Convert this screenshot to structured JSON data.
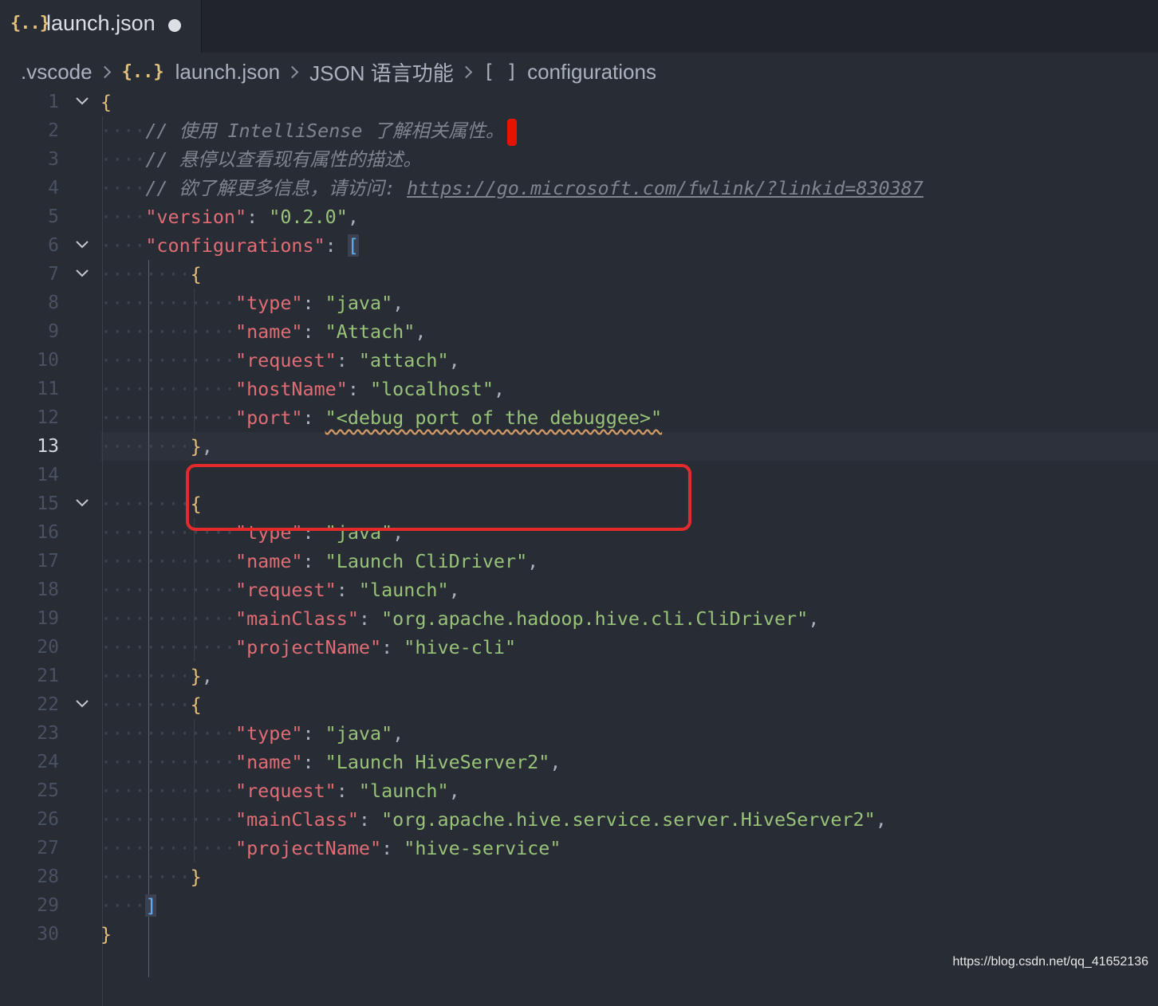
{
  "tab": {
    "icon": "{..}",
    "title": "launch.json",
    "dirty_indicator": "●"
  },
  "breadcrumb": [
    {
      "label": ".vscode"
    },
    {
      "icon": "{..}",
      "label": "launch.json"
    },
    {
      "label": "JSON 语言功能"
    },
    {
      "icon": "[ ]",
      "label": "configurations"
    }
  ],
  "active_line": 13,
  "lines": [
    {
      "n": "1",
      "fold": true,
      "indent": 0,
      "tokens": [
        {
          "t": "{",
          "c": "b1"
        }
      ]
    },
    {
      "n": "2",
      "fold": false,
      "indent": 1,
      "tokens": [
        {
          "t": "// 使用 IntelliSense 了解相关属性。",
          "c": "c"
        }
      ],
      "cursor": true
    },
    {
      "n": "3",
      "fold": false,
      "indent": 1,
      "tokens": [
        {
          "t": "// 悬停以查看现有属性的描述。",
          "c": "c"
        }
      ]
    },
    {
      "n": "4",
      "fold": false,
      "indent": 1,
      "tokens": [
        {
          "t": "// 欲了解更多信息，请访问: ",
          "c": "c"
        },
        {
          "t": "https://go.microsoft.com/fwlink/?linkid=830387",
          "c": "cu"
        }
      ]
    },
    {
      "n": "5",
      "fold": false,
      "indent": 1,
      "tokens": [
        {
          "t": "\"version\"",
          "c": "k"
        },
        {
          "t": ": ",
          "c": "p"
        },
        {
          "t": "\"0.2.0\"",
          "c": "s"
        },
        {
          "t": ",",
          "c": "p"
        }
      ]
    },
    {
      "n": "6",
      "fold": true,
      "indent": 1,
      "tokens": [
        {
          "t": "\"configurations\"",
          "c": "k"
        },
        {
          "t": ": ",
          "c": "p"
        },
        {
          "t": "[",
          "c": "b2"
        }
      ]
    },
    {
      "n": "7",
      "fold": true,
      "indent": 2,
      "tokens": [
        {
          "t": "{",
          "c": "b1"
        }
      ]
    },
    {
      "n": "8",
      "fold": false,
      "indent": 3,
      "tokens": [
        {
          "t": "\"type\"",
          "c": "k"
        },
        {
          "t": ": ",
          "c": "p"
        },
        {
          "t": "\"java\"",
          "c": "s"
        },
        {
          "t": ",",
          "c": "p"
        }
      ]
    },
    {
      "n": "9",
      "fold": false,
      "indent": 3,
      "tokens": [
        {
          "t": "\"name\"",
          "c": "k"
        },
        {
          "t": ": ",
          "c": "p"
        },
        {
          "t": "\"Attach\"",
          "c": "s"
        },
        {
          "t": ",",
          "c": "p"
        }
      ]
    },
    {
      "n": "10",
      "fold": false,
      "indent": 3,
      "tokens": [
        {
          "t": "\"request\"",
          "c": "k"
        },
        {
          "t": ": ",
          "c": "p"
        },
        {
          "t": "\"attach\"",
          "c": "s"
        },
        {
          "t": ",",
          "c": "p"
        }
      ]
    },
    {
      "n": "11",
      "fold": false,
      "indent": 3,
      "tokens": [
        {
          "t": "\"hostName\"",
          "c": "k"
        },
        {
          "t": ": ",
          "c": "p"
        },
        {
          "t": "\"localhost\"",
          "c": "s"
        },
        {
          "t": ",",
          "c": "p"
        }
      ]
    },
    {
      "n": "12",
      "fold": false,
      "indent": 3,
      "tokens": [
        {
          "t": "\"port\"",
          "c": "k"
        },
        {
          "t": ": ",
          "c": "p"
        },
        {
          "t": "\"<debug port of the debuggee>\"",
          "c": "s squig"
        }
      ]
    },
    {
      "n": "13",
      "fold": false,
      "indent": 2,
      "tokens": [
        {
          "t": "}",
          "c": "b1"
        },
        {
          "t": ",",
          "c": "p"
        }
      ]
    },
    {
      "n": "14",
      "fold": false,
      "indent": 0,
      "tokens": []
    },
    {
      "n": "15",
      "fold": true,
      "indent": 2,
      "tokens": [
        {
          "t": "{",
          "c": "b1"
        }
      ]
    },
    {
      "n": "16",
      "fold": false,
      "indent": 3,
      "tokens": [
        {
          "t": "\"type\"",
          "c": "k"
        },
        {
          "t": ": ",
          "c": "p"
        },
        {
          "t": "\"java\"",
          "c": "s"
        },
        {
          "t": ",",
          "c": "p"
        }
      ]
    },
    {
      "n": "17",
      "fold": false,
      "indent": 3,
      "tokens": [
        {
          "t": "\"name\"",
          "c": "k"
        },
        {
          "t": ": ",
          "c": "p"
        },
        {
          "t": "\"Launch CliDriver\"",
          "c": "s"
        },
        {
          "t": ",",
          "c": "p"
        }
      ]
    },
    {
      "n": "18",
      "fold": false,
      "indent": 3,
      "tokens": [
        {
          "t": "\"request\"",
          "c": "k"
        },
        {
          "t": ": ",
          "c": "p"
        },
        {
          "t": "\"launch\"",
          "c": "s"
        },
        {
          "t": ",",
          "c": "p"
        }
      ]
    },
    {
      "n": "19",
      "fold": false,
      "indent": 3,
      "tokens": [
        {
          "t": "\"mainClass\"",
          "c": "k"
        },
        {
          "t": ": ",
          "c": "p"
        },
        {
          "t": "\"org.apache.hadoop.hive.cli.CliDriver\"",
          "c": "s"
        },
        {
          "t": ",",
          "c": "p"
        }
      ]
    },
    {
      "n": "20",
      "fold": false,
      "indent": 3,
      "tokens": [
        {
          "t": "\"projectName\"",
          "c": "k"
        },
        {
          "t": ": ",
          "c": "p"
        },
        {
          "t": "\"hive-cli\"",
          "c": "s"
        }
      ]
    },
    {
      "n": "21",
      "fold": false,
      "indent": 2,
      "tokens": [
        {
          "t": "}",
          "c": "b1"
        },
        {
          "t": ",",
          "c": "p"
        }
      ]
    },
    {
      "n": "22",
      "fold": true,
      "indent": 2,
      "tokens": [
        {
          "t": "{",
          "c": "b1"
        }
      ]
    },
    {
      "n": "23",
      "fold": false,
      "indent": 3,
      "tokens": [
        {
          "t": "\"type\"",
          "c": "k"
        },
        {
          "t": ": ",
          "c": "p"
        },
        {
          "t": "\"java\"",
          "c": "s"
        },
        {
          "t": ",",
          "c": "p"
        }
      ]
    },
    {
      "n": "24",
      "fold": false,
      "indent": 3,
      "tokens": [
        {
          "t": "\"name\"",
          "c": "k"
        },
        {
          "t": ": ",
          "c": "p"
        },
        {
          "t": "\"Launch HiveServer2\"",
          "c": "s"
        },
        {
          "t": ",",
          "c": "p"
        }
      ]
    },
    {
      "n": "25",
      "fold": false,
      "indent": 3,
      "tokens": [
        {
          "t": "\"request\"",
          "c": "k"
        },
        {
          "t": ": ",
          "c": "p"
        },
        {
          "t": "\"launch\"",
          "c": "s"
        },
        {
          "t": ",",
          "c": "p"
        }
      ]
    },
    {
      "n": "26",
      "fold": false,
      "indent": 3,
      "tokens": [
        {
          "t": "\"mainClass\"",
          "c": "k"
        },
        {
          "t": ": ",
          "c": "p"
        },
        {
          "t": "\"org.apache.hive.service.server.HiveServer2\"",
          "c": "s"
        },
        {
          "t": ",",
          "c": "p"
        }
      ]
    },
    {
      "n": "27",
      "fold": false,
      "indent": 3,
      "tokens": [
        {
          "t": "\"projectName\"",
          "c": "k"
        },
        {
          "t": ": ",
          "c": "p"
        },
        {
          "t": "\"hive-service\"",
          "c": "s"
        }
      ]
    },
    {
      "n": "28",
      "fold": false,
      "indent": 2,
      "tokens": [
        {
          "t": "}",
          "c": "b1"
        }
      ]
    },
    {
      "n": "29",
      "fold": false,
      "indent": 1,
      "tokens": [
        {
          "t": "]",
          "c": "b2"
        }
      ]
    },
    {
      "n": "30",
      "fold": false,
      "indent": 0,
      "tokens": [
        {
          "t": "}",
          "c": "b1"
        }
      ]
    }
  ],
  "watermark": "https://blog.csdn.net/qq_41652136",
  "colors": {
    "background": "#282c34",
    "key": "#e06c75",
    "string": "#98c379",
    "comment": "#7f848e",
    "brace": "#e5c07b",
    "bracket": "#61afef",
    "highlight_box": "#e32b2b"
  }
}
